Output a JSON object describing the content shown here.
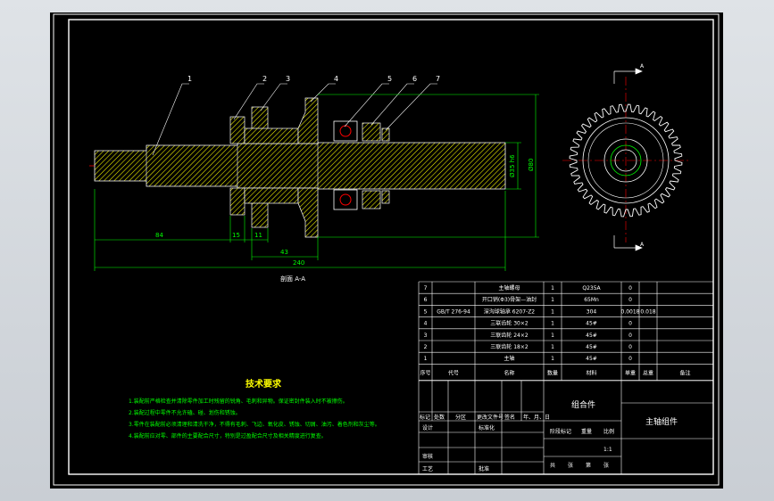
{
  "colors": {
    "frame": "#ffffff",
    "outline": "#ffffff",
    "dimension": "#00ff00",
    "hatch": "#ffff00",
    "centerline": "#ff0000",
    "note_title": "#ffff00",
    "note_text": "#00ff00",
    "table_text": "#ffffff"
  },
  "leaders": [
    "1",
    "2",
    "3",
    "4",
    "5",
    "6",
    "7"
  ],
  "dimensions": {
    "d84": "84",
    "d15": "15",
    "d11": "11",
    "d43": "43",
    "d240": "240",
    "d_dia_shaft": "Ø35 h6",
    "d_dia_big": "Ø80"
  },
  "section_label": "剖面 A-A",
  "section_marks": [
    "A",
    "A"
  ],
  "notes": {
    "title": "技术要求",
    "lines": [
      "1.装配前严格检查并清除零件加工时残留的锐角、毛刺和异物。保证密封件装入时不被擦伤。",
      "2.装配过程中零件不允许磕、碰、划伤和锈蚀。",
      "3.零件在装配前必须清理和清洗干净，不得有毛刺、飞边、氧化皮、锈蚀、切屑、油污、着色剂和灰尘等。",
      "4.装配前应对零、部件的主要配合尺寸，特别是过盈配合尺寸及相关精度进行复查。"
    ]
  },
  "bom": [
    {
      "no": "7",
      "code": "",
      "name": "主轴螺母",
      "qty": "1",
      "material": "Q235A",
      "weight": "0",
      "total": "",
      "note": ""
    },
    {
      "no": "6",
      "code": "",
      "name": "开口销(Φ3)骨架—油封",
      "qty": "1",
      "material": "65Mn",
      "weight": "0",
      "total": "",
      "note": ""
    },
    {
      "no": "5",
      "code": "GB/T 276-94",
      "name": "深沟球轴承 6207-Z2",
      "qty": "1",
      "material": "304",
      "weight": "0.0018",
      "total": "0.018",
      "note": ""
    },
    {
      "no": "4",
      "code": "",
      "name": "三联齿轮 30×2",
      "qty": "1",
      "material": "45#",
      "weight": "0",
      "total": "",
      "note": ""
    },
    {
      "no": "3",
      "code": "",
      "name": "三联齿轮 24×2",
      "qty": "1",
      "material": "45#",
      "weight": "0",
      "total": "",
      "note": ""
    },
    {
      "no": "2",
      "code": "",
      "name": "三联齿轮 18×2",
      "qty": "1",
      "material": "45#",
      "weight": "0",
      "total": "",
      "note": ""
    },
    {
      "no": "1",
      "code": "",
      "name": "主轴",
      "qty": "1",
      "material": "45#",
      "weight": "0",
      "total": "",
      "note": ""
    }
  ],
  "bom_header": {
    "no": "序号",
    "code": "代号",
    "name": "名称",
    "qty": "数量",
    "material": "材料",
    "weight": "单重",
    "total": "总重",
    "note": "备注"
  },
  "title_block": {
    "center_title": "组合件",
    "drawing_name": "主轴组件",
    "rev_headers": [
      "标记",
      "处数",
      "分区",
      "更改文件号",
      "签名",
      "年、月、日"
    ],
    "design": "设计",
    "standard": "标准化",
    "review": "审核",
    "process": "工艺",
    "approve": "批准",
    "stage": "阶段标记",
    "weight": "重量",
    "scale": "比例",
    "scale_value": "1:1",
    "sheets": [
      "共",
      "张",
      "第",
      "张"
    ]
  }
}
